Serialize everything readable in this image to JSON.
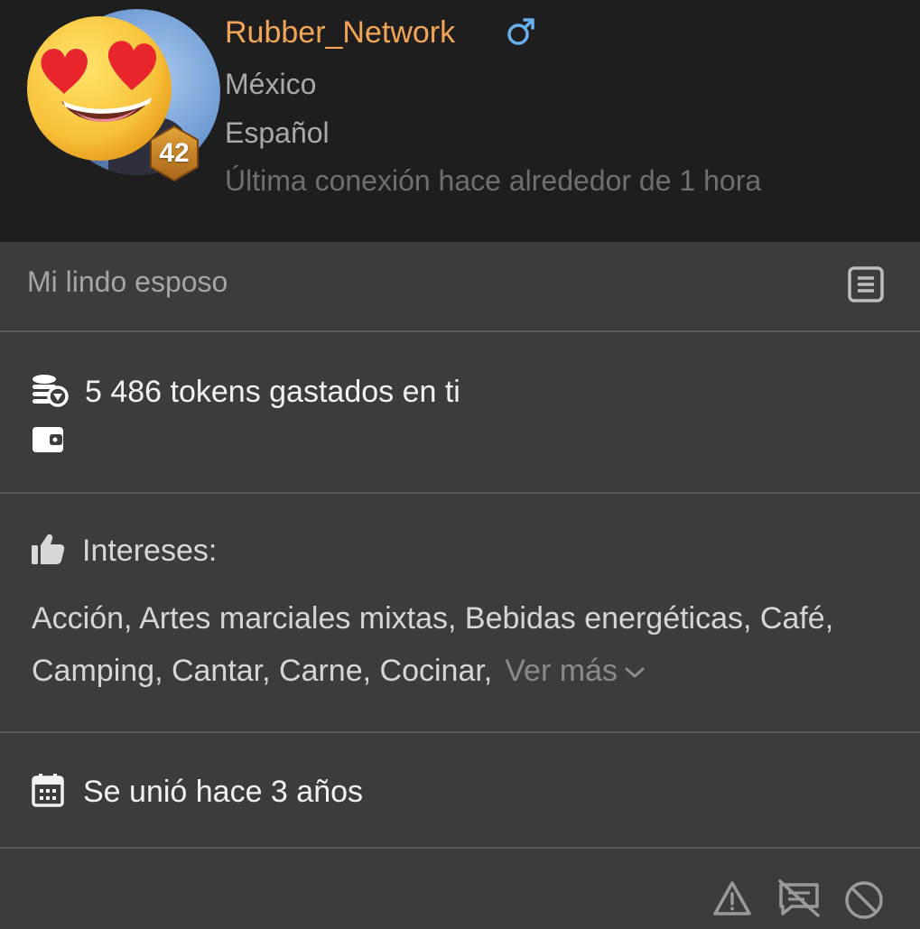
{
  "profile": {
    "username": "Rubber_Network",
    "gender_icon": "male-icon",
    "level": "42",
    "country": "México",
    "language": "Español",
    "last_seen": "Última conexión hace alrededor de 1 hora"
  },
  "bio": {
    "text": "Mi lindo esposo",
    "icon": "notes-icon"
  },
  "tokens": {
    "text": "5 486 tokens gastados en ti",
    "icon": "coins-icon",
    "wallet_icon": "wallet-icon"
  },
  "interests": {
    "label": "Intereses:",
    "list": "Acción, Artes marciales mixtas, Bebidas energéticas, Café, Camping, Cantar, Carne, Cocinar,",
    "see_more": "Ver más",
    "icon": "thumbs-up-icon"
  },
  "joined": {
    "text": "Se unió hace 3 años",
    "icon": "calendar-icon"
  },
  "actions": [
    "report-icon",
    "block-messages-icon",
    "block-icon"
  ],
  "colors": {
    "username": "#f2a655",
    "gender": "#6ab0f0",
    "header_bg": "#1e1e1e",
    "body_bg": "#3c3c3c"
  }
}
